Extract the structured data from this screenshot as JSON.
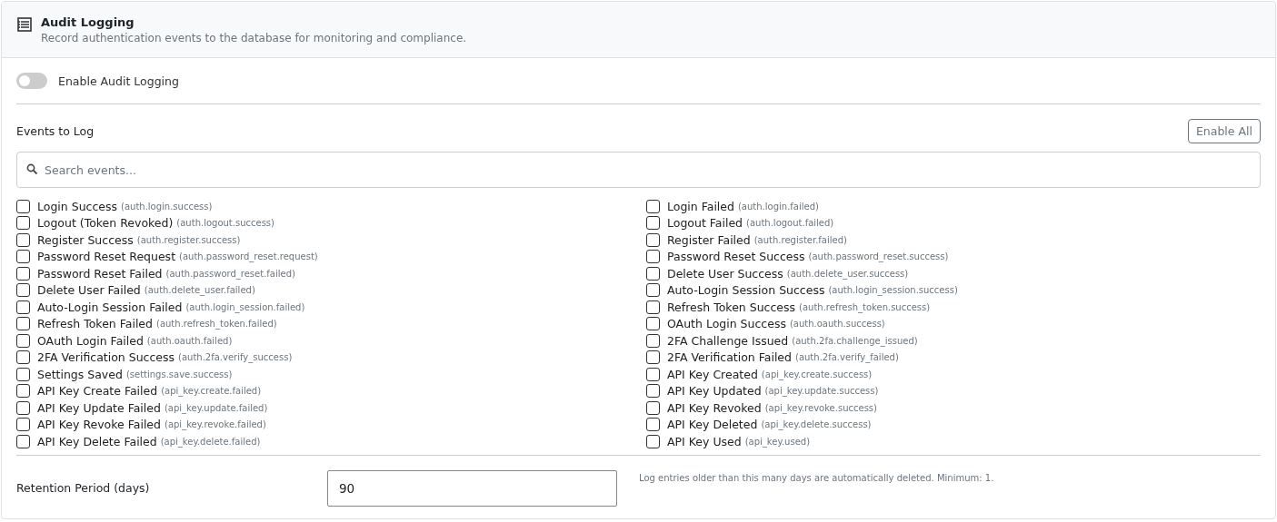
{
  "header": {
    "title": "Audit Logging",
    "description": "Record authentication events to the database for monitoring and compliance."
  },
  "enable_toggle": {
    "label": "Enable Audit Logging",
    "on": false
  },
  "events": {
    "heading": "Events to Log",
    "enable_all_button": "Enable All",
    "search": {
      "placeholder": "Search events..."
    },
    "items": [
      {
        "label": "Login Success",
        "code": "(auth.login.success)",
        "checked": false
      },
      {
        "label": "Login Failed",
        "code": "(auth.login.failed)",
        "checked": false
      },
      {
        "label": "Logout (Token Revoked)",
        "code": "(auth.logout.success)",
        "checked": false
      },
      {
        "label": "Logout Failed",
        "code": "(auth.logout.failed)",
        "checked": false
      },
      {
        "label": "Register Success",
        "code": "(auth.register.success)",
        "checked": false
      },
      {
        "label": "Register Failed",
        "code": "(auth.register.failed)",
        "checked": false
      },
      {
        "label": "Password Reset Request",
        "code": "(auth.password_reset.request)",
        "checked": false
      },
      {
        "label": "Password Reset Success",
        "code": "(auth.password_reset.success)",
        "checked": false
      },
      {
        "label": "Password Reset Failed",
        "code": "(auth.password_reset.failed)",
        "checked": false
      },
      {
        "label": "Delete User Success",
        "code": "(auth.delete_user.success)",
        "checked": false
      },
      {
        "label": "Delete User Failed",
        "code": "(auth.delete_user.failed)",
        "checked": false
      },
      {
        "label": "Auto-Login Session Success",
        "code": "(auth.login_session.success)",
        "checked": false
      },
      {
        "label": "Auto-Login Session Failed",
        "code": "(auth.login_session.failed)",
        "checked": false
      },
      {
        "label": "Refresh Token Success",
        "code": "(auth.refresh_token.success)",
        "checked": false
      },
      {
        "label": "Refresh Token Failed",
        "code": "(auth.refresh_token.failed)",
        "checked": false
      },
      {
        "label": "OAuth Login Success",
        "code": "(auth.oauth.success)",
        "checked": false
      },
      {
        "label": "OAuth Login Failed",
        "code": "(auth.oauth.failed)",
        "checked": false
      },
      {
        "label": "2FA Challenge Issued",
        "code": "(auth.2fa.challenge_issued)",
        "checked": false
      },
      {
        "label": "2FA Verification Success",
        "code": "(auth.2fa.verify_success)",
        "checked": false
      },
      {
        "label": "2FA Verification Failed",
        "code": "(auth.2fa.verify_failed)",
        "checked": false
      },
      {
        "label": "Settings Saved",
        "code": "(settings.save.success)",
        "checked": false
      },
      {
        "label": "API Key Created",
        "code": "(api_key.create.success)",
        "checked": false
      },
      {
        "label": "API Key Create Failed",
        "code": "(api_key.create.failed)",
        "checked": false
      },
      {
        "label": "API Key Updated",
        "code": "(api_key.update.success)",
        "checked": false
      },
      {
        "label": "API Key Update Failed",
        "code": "(api_key.update.failed)",
        "checked": false
      },
      {
        "label": "API Key Revoked",
        "code": "(api_key.revoke.success)",
        "checked": false
      },
      {
        "label": "API Key Revoke Failed",
        "code": "(api_key.revoke.failed)",
        "checked": false
      },
      {
        "label": "API Key Deleted",
        "code": "(api_key.delete.success)",
        "checked": false
      },
      {
        "label": "API Key Delete Failed",
        "code": "(api_key.delete.failed)",
        "checked": false
      },
      {
        "label": "API Key Used",
        "code": "(api_key.used)",
        "checked": false
      }
    ]
  },
  "retention": {
    "label": "Retention Period (days)",
    "value": "90",
    "hint": "Log entries older than this many days are automatically deleted. Minimum: 1."
  }
}
